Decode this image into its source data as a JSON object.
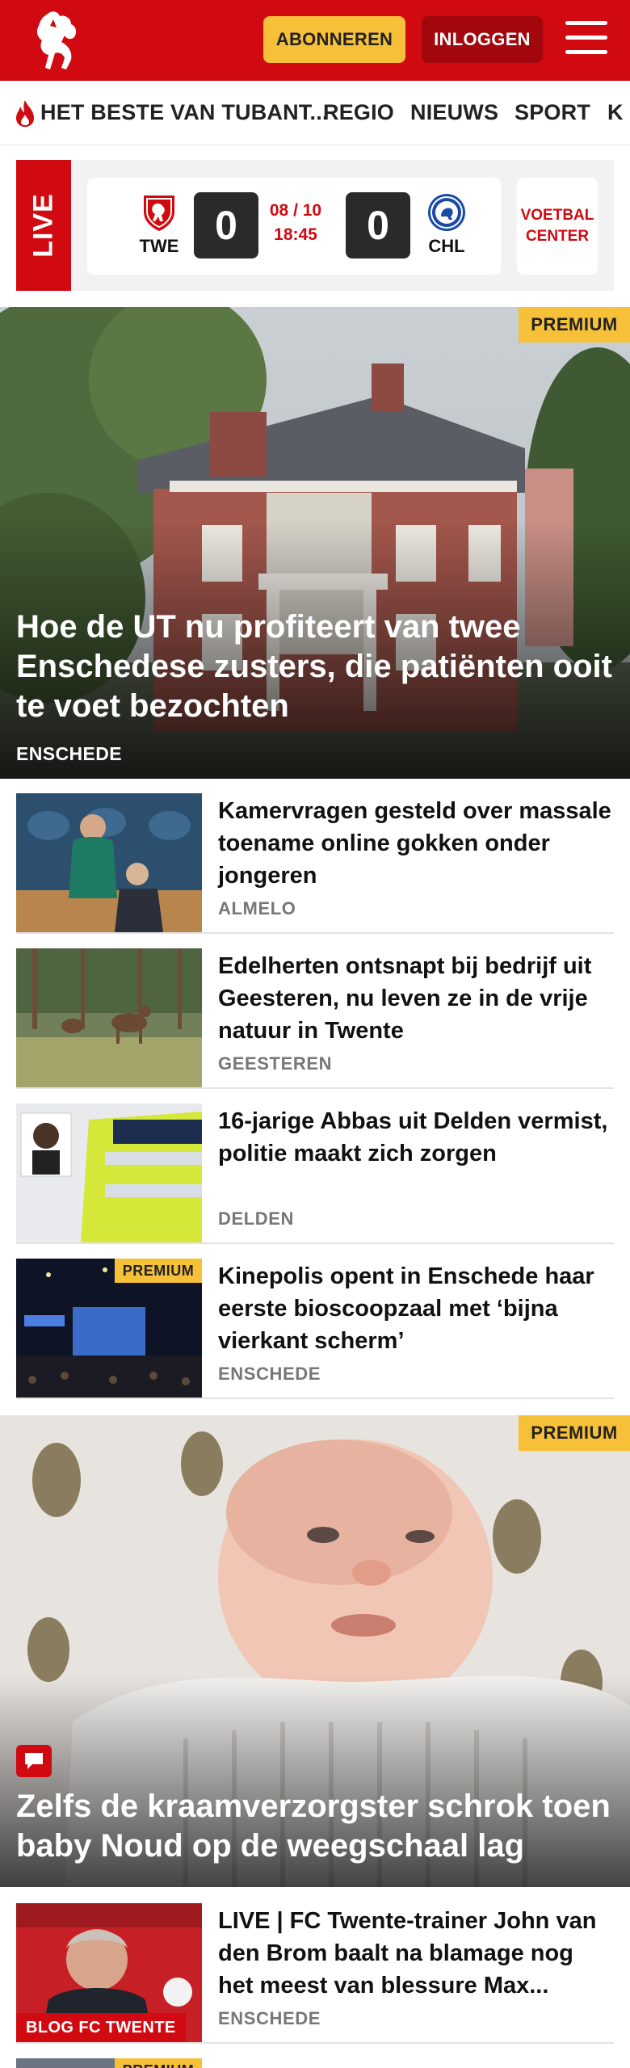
{
  "header": {
    "subscribe_label": "ABONNEREN",
    "login_label": "INLOGGEN",
    "brand_color": "#d10a11",
    "subscribe_color": "#f6c039"
  },
  "nav": {
    "items": [
      {
        "label": "HET BESTE VAN TUBANT...",
        "icon": "flame-icon"
      },
      {
        "label": "REGIO"
      },
      {
        "label": "NIEUWS"
      },
      {
        "label": "SPORT"
      },
      {
        "label": "K"
      }
    ]
  },
  "live": {
    "tag": "LIVE",
    "home_team": "TWE",
    "away_team": "CHL",
    "home_score": "0",
    "away_score": "0",
    "date": "08 / 10",
    "time": "18:45",
    "voetbal_center": "VOETBAL CENTER"
  },
  "hero1": {
    "premium": "PREMIUM",
    "title": "Hoe de UT nu profiteert van twee Enschedese zusters, die patiënten ooit te voet bezochten",
    "location": "ENSCHEDE"
  },
  "articles": [
    {
      "title": "Kamervragen gesteld over massale toename online gokken onder jongeren",
      "location": "ALMELO"
    },
    {
      "title": "Edelherten ontsnapt bij bedrijf uit Geesteren, nu leven ze in de vrije natuur in Twente",
      "location": "GEESTEREN"
    },
    {
      "title": "16-jarige Abbas uit Delden vermist, politie maakt zich zorgen",
      "location": "DELDEN"
    },
    {
      "title": "Kinepolis opent in Enschede haar eerste bioscoopzaal met ‘bijna vierkant scherm’",
      "location": "ENSCHEDE",
      "premium": "PREMIUM"
    }
  ],
  "hero2": {
    "premium": "PREMIUM",
    "title": "Zelfs de kraamverzorgster schrok toen baby Noud op de weegschaal lag"
  },
  "articles2": [
    {
      "title": "LIVE | FC Twente-trainer John van den Brom baalt na blamage nog het meest van blessure Max...",
      "location": "ENSCHEDE",
      "tag": "BLOG FC TWENTE"
    },
    {
      "premium": "PREMIUM"
    }
  ]
}
